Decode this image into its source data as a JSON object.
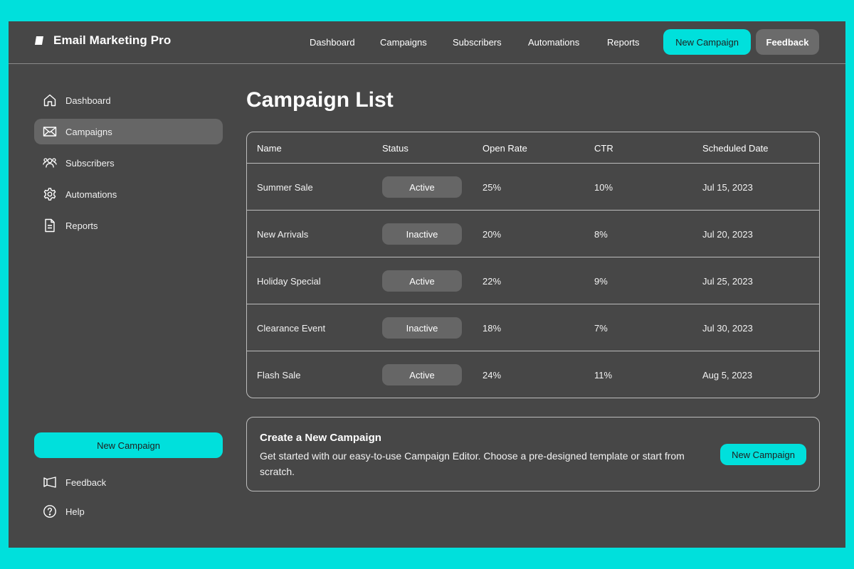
{
  "app": {
    "title": "Email Marketing Pro",
    "accent_color": "#00E0DC",
    "background_color": "#474747"
  },
  "header": {
    "nav": [
      "Dashboard",
      "Campaigns",
      "Subscribers",
      "Automations",
      "Reports"
    ],
    "new_campaign_label": "New Campaign",
    "feedback_label": "Feedback"
  },
  "sidebar": {
    "items": [
      {
        "label": "Dashboard",
        "icon": "home-icon",
        "active": false
      },
      {
        "label": "Campaigns",
        "icon": "mail-icon",
        "active": true
      },
      {
        "label": "Subscribers",
        "icon": "users-icon",
        "active": false
      },
      {
        "label": "Automations",
        "icon": "gear-icon",
        "active": false
      },
      {
        "label": "Reports",
        "icon": "document-icon",
        "active": false
      }
    ],
    "new_campaign_label": "New Campaign",
    "feedback_label": "Feedback",
    "help_label": "Help"
  },
  "main": {
    "title": "Campaign List",
    "table": {
      "columns": [
        "Name",
        "Status",
        "Open Rate",
        "CTR",
        "Scheduled Date"
      ],
      "rows": [
        {
          "name": "Summer Sale",
          "status": "Active",
          "open_rate": "25%",
          "ctr": "10%",
          "date": "Jul 15, 2023"
        },
        {
          "name": "New Arrivals",
          "status": "Inactive",
          "open_rate": "20%",
          "ctr": "8%",
          "date": "Jul 20, 2023"
        },
        {
          "name": "Holiday Special",
          "status": "Active",
          "open_rate": "22%",
          "ctr": "9%",
          "date": "Jul 25, 2023"
        },
        {
          "name": "Clearance Event",
          "status": "Inactive",
          "open_rate": "18%",
          "ctr": "7%",
          "date": "Jul 30, 2023"
        },
        {
          "name": "Flash Sale",
          "status": "Active",
          "open_rate": "24%",
          "ctr": "11%",
          "date": "Aug 5, 2023"
        }
      ]
    },
    "cta": {
      "title": "Create a New Campaign",
      "description": "Get started with our easy-to-use Campaign Editor. Choose a pre-designed template or start from scratch.",
      "button_label": "New Campaign"
    }
  }
}
